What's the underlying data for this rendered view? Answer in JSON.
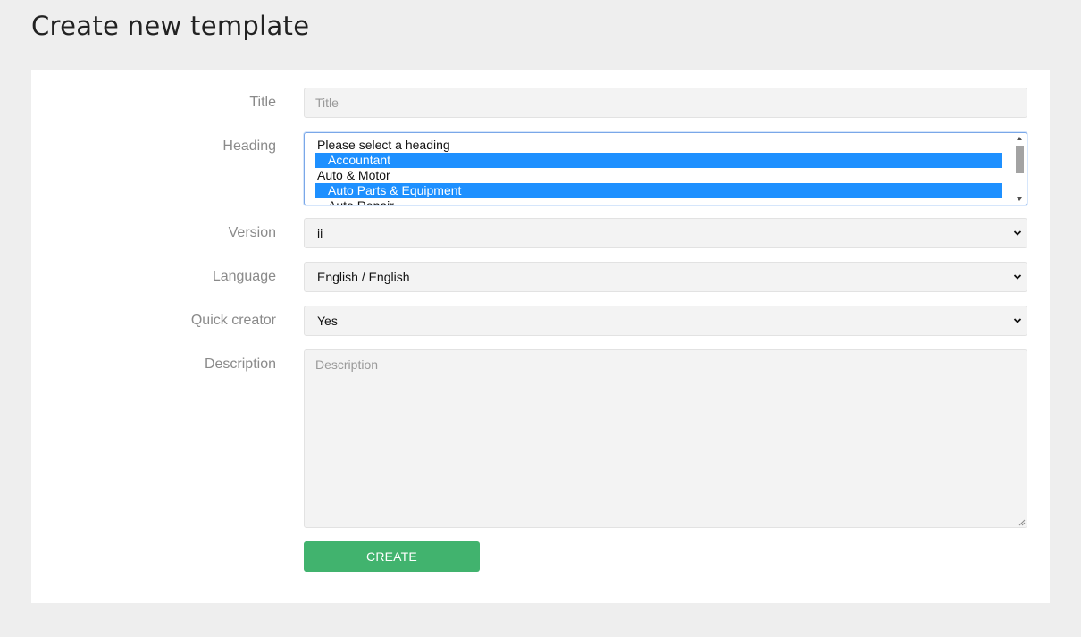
{
  "page": {
    "title": "Create new template"
  },
  "form": {
    "title": {
      "label": "Title",
      "value": "",
      "placeholder": "Title"
    },
    "heading": {
      "label": "Heading",
      "options": [
        {
          "label": "Please select a heading",
          "selected": false,
          "indent": false
        },
        {
          "label": "Accountant",
          "selected": true,
          "indent": true
        },
        {
          "label": "Auto & Motor",
          "selected": false,
          "indent": false
        },
        {
          "label": "Auto Parts & Equipment",
          "selected": true,
          "indent": true
        },
        {
          "label": "Auto Repair",
          "selected": false,
          "indent": true
        }
      ]
    },
    "version": {
      "label": "Version",
      "value": "ii"
    },
    "language": {
      "label": "Language",
      "value": "English / English"
    },
    "quick_creator": {
      "label": "Quick creator",
      "value": "Yes"
    },
    "description": {
      "label": "Description",
      "value": "",
      "placeholder": "Description"
    },
    "submit_label": "CREATE"
  },
  "colors": {
    "background": "#eeeeee",
    "card": "#ffffff",
    "selection": "#1e90ff",
    "create_button": "#41b36e"
  },
  "icons": {
    "select_arrow": "chevron-down-icon",
    "scroll_up": "triangle-up-icon",
    "scroll_down": "triangle-down-icon",
    "resize": "resize-grip-icon"
  }
}
